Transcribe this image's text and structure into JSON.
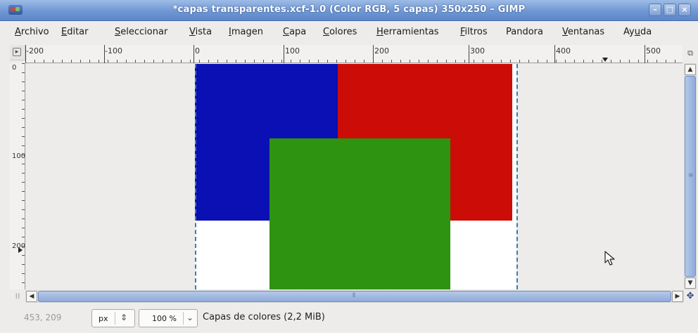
{
  "window": {
    "title": "*capas transparentes.xcf-1.0 (Color RGB, 5 capas) 350x250 – GIMP",
    "minimize_glyph": "–",
    "maximize_glyph": "□",
    "close_glyph": "×"
  },
  "menu": [
    {
      "pre": "",
      "ul": "A",
      "post": "rchivo"
    },
    {
      "pre": "",
      "ul": "E",
      "post": "ditar"
    },
    {
      "pre": "",
      "ul": "S",
      "post": "eleccionar"
    },
    {
      "pre": "",
      "ul": "V",
      "post": "ista"
    },
    {
      "pre": "",
      "ul": "I",
      "post": "magen"
    },
    {
      "pre": "",
      "ul": "C",
      "post": "apa"
    },
    {
      "pre": "",
      "ul": "C",
      "post": "olores"
    },
    {
      "pre": "",
      "ul": "H",
      "post": "erramientas"
    },
    {
      "pre": "",
      "ul": "F",
      "post": "iltros"
    },
    {
      "pre": "Pandora",
      "ul": "",
      "post": ""
    },
    {
      "pre": "",
      "ul": "V",
      "post": "entanas"
    },
    {
      "pre": "Ay",
      "ul": "u",
      "post": "da"
    }
  ],
  "ruler": {
    "h_labels": [
      "-200",
      "-100",
      "0",
      "100",
      "200",
      "300",
      "400",
      "500"
    ],
    "v_labels": [
      "0",
      "100",
      "200"
    ]
  },
  "image": {
    "colors": {
      "blue": "#0a10b4",
      "red": "#cc0c06",
      "green": "#2e9310",
      "background": "#ffffff",
      "boundary": "#3a7fa8"
    }
  },
  "statusbar": {
    "coords": "453, 209",
    "unit": "px",
    "zoom": "100 %",
    "message": "Capas de colores (2,2 MiB)"
  },
  "icons": {
    "app": "gimp-icon",
    "navigate": "navigate-icon",
    "pointer": "mouse-pointer-icon"
  }
}
